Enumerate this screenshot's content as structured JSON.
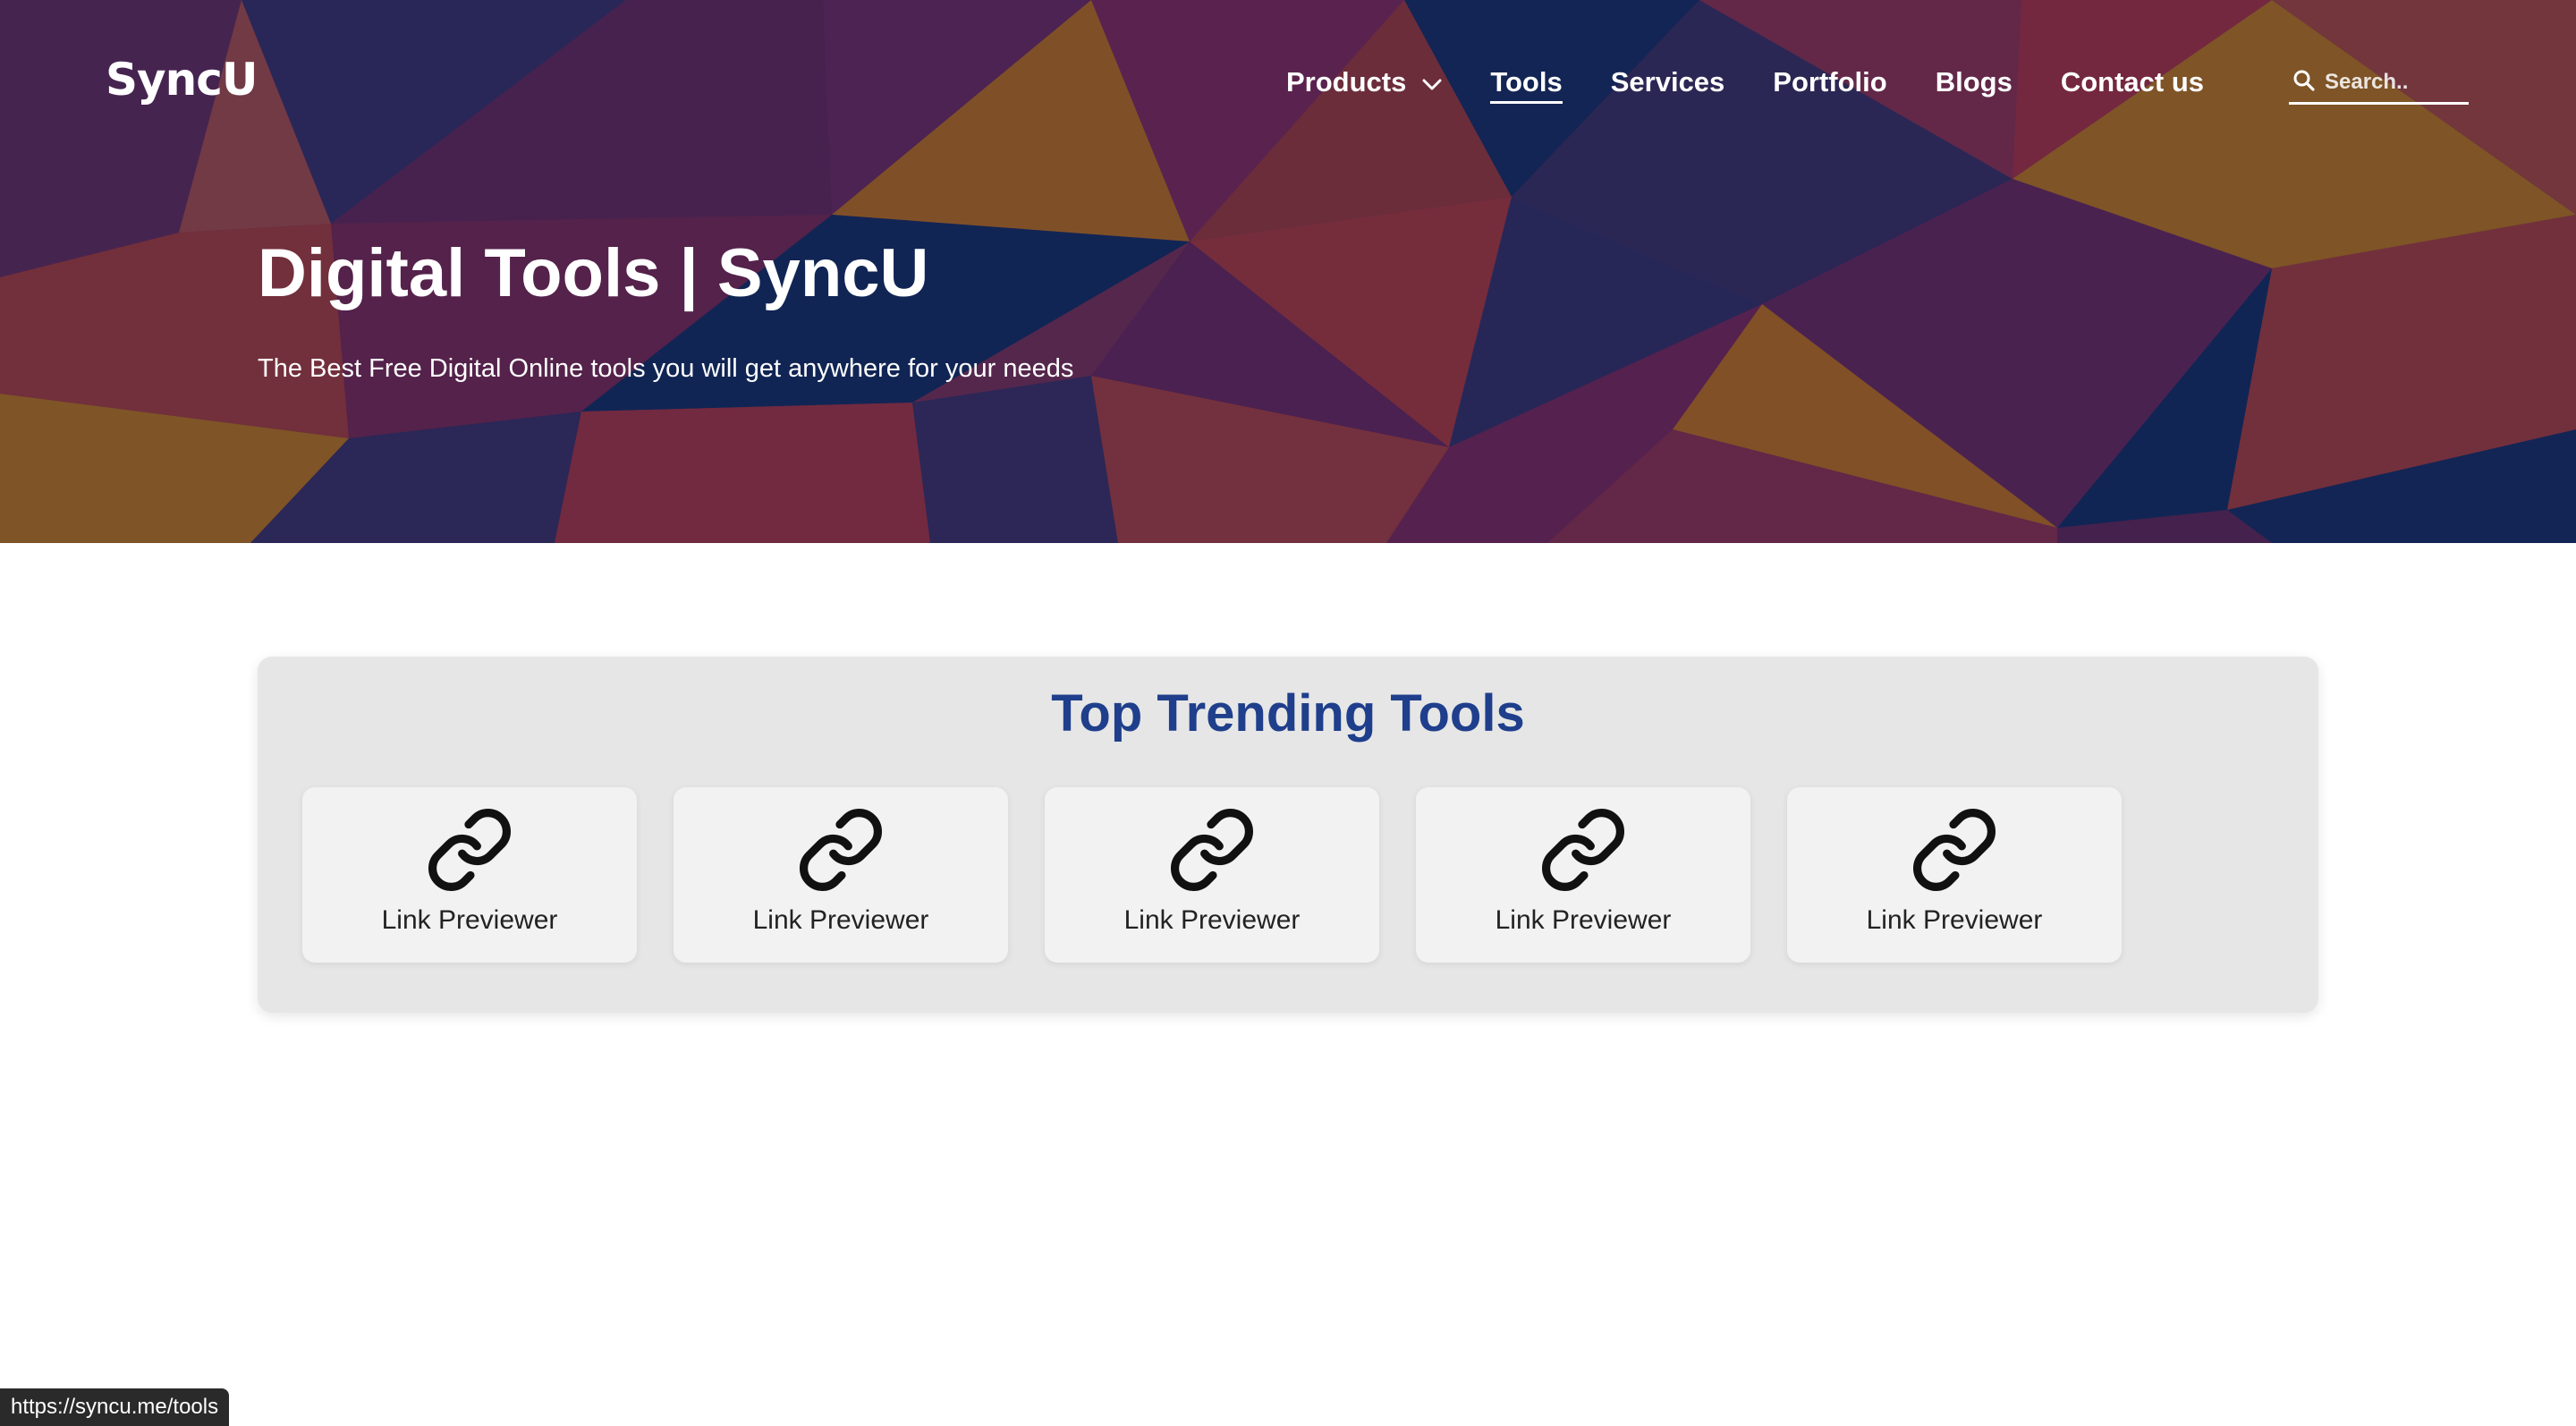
{
  "header": {
    "logo_text": "SyncU",
    "nav": [
      {
        "label": "Products",
        "has_dropdown": true,
        "active": false
      },
      {
        "label": "Tools",
        "has_dropdown": false,
        "active": true
      },
      {
        "label": "Services",
        "has_dropdown": false,
        "active": false
      },
      {
        "label": "Portfolio",
        "has_dropdown": false,
        "active": false
      },
      {
        "label": "Blogs",
        "has_dropdown": false,
        "active": false
      },
      {
        "label": "Contact us",
        "has_dropdown": false,
        "active": false
      }
    ],
    "search": {
      "placeholder": "Search..",
      "value": "",
      "icon": "search-icon"
    }
  },
  "hero": {
    "title": "Digital Tools | SyncU",
    "subtitle": "The Best Free Digital Online tools you will get anywhere for your needs"
  },
  "trending": {
    "heading": "Top Trending Tools",
    "tools": [
      {
        "label": "Link Previewer",
        "icon": "link-icon"
      },
      {
        "label": "Link Previewer",
        "icon": "link-icon"
      },
      {
        "label": "Link Previewer",
        "icon": "link-icon"
      },
      {
        "label": "Link Previewer",
        "icon": "link-icon"
      },
      {
        "label": "Link Previewer",
        "icon": "link-icon"
      }
    ]
  },
  "status_bar": {
    "url": "https://syncu.me/tools"
  },
  "colors": {
    "heading_blue": "#1f3f8c",
    "panel_bg": "#e6e6e6",
    "card_bg": "#f2f2f2",
    "hero_purple": "#5b2a52",
    "hero_navy": "#13285a",
    "hero_orange": "#8a5a2a",
    "hero_red": "#7f3040"
  }
}
